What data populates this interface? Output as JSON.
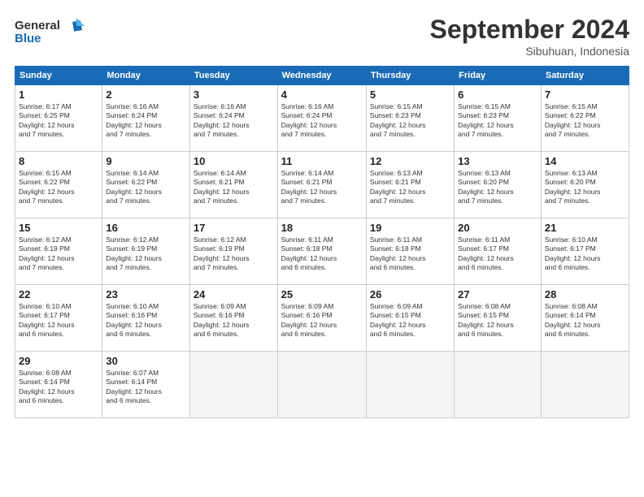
{
  "header": {
    "logo_line1": "General",
    "logo_line2": "Blue",
    "month_title": "September 2024",
    "location": "Sibuhuan, Indonesia"
  },
  "days_of_week": [
    "Sunday",
    "Monday",
    "Tuesday",
    "Wednesday",
    "Thursday",
    "Friday",
    "Saturday"
  ],
  "weeks": [
    [
      {
        "day": "1",
        "info": "Sunrise: 6:17 AM\nSunset: 6:25 PM\nDaylight: 12 hours\nand 7 minutes."
      },
      {
        "day": "2",
        "info": "Sunrise: 6:16 AM\nSunset: 6:24 PM\nDaylight: 12 hours\nand 7 minutes."
      },
      {
        "day": "3",
        "info": "Sunrise: 6:16 AM\nSunset: 6:24 PM\nDaylight: 12 hours\nand 7 minutes."
      },
      {
        "day": "4",
        "info": "Sunrise: 6:16 AM\nSunset: 6:24 PM\nDaylight: 12 hours\nand 7 minutes."
      },
      {
        "day": "5",
        "info": "Sunrise: 6:15 AM\nSunset: 6:23 PM\nDaylight: 12 hours\nand 7 minutes."
      },
      {
        "day": "6",
        "info": "Sunrise: 6:15 AM\nSunset: 6:23 PM\nDaylight: 12 hours\nand 7 minutes."
      },
      {
        "day": "7",
        "info": "Sunrise: 6:15 AM\nSunset: 6:22 PM\nDaylight: 12 hours\nand 7 minutes."
      }
    ],
    [
      {
        "day": "8",
        "info": "Sunrise: 6:15 AM\nSunset: 6:22 PM\nDaylight: 12 hours\nand 7 minutes."
      },
      {
        "day": "9",
        "info": "Sunrise: 6:14 AM\nSunset: 6:22 PM\nDaylight: 12 hours\nand 7 minutes."
      },
      {
        "day": "10",
        "info": "Sunrise: 6:14 AM\nSunset: 6:21 PM\nDaylight: 12 hours\nand 7 minutes."
      },
      {
        "day": "11",
        "info": "Sunrise: 6:14 AM\nSunset: 6:21 PM\nDaylight: 12 hours\nand 7 minutes."
      },
      {
        "day": "12",
        "info": "Sunrise: 6:13 AM\nSunset: 6:21 PM\nDaylight: 12 hours\nand 7 minutes."
      },
      {
        "day": "13",
        "info": "Sunrise: 6:13 AM\nSunset: 6:20 PM\nDaylight: 12 hours\nand 7 minutes."
      },
      {
        "day": "14",
        "info": "Sunrise: 6:13 AM\nSunset: 6:20 PM\nDaylight: 12 hours\nand 7 minutes."
      }
    ],
    [
      {
        "day": "15",
        "info": "Sunrise: 6:12 AM\nSunset: 6:19 PM\nDaylight: 12 hours\nand 7 minutes."
      },
      {
        "day": "16",
        "info": "Sunrise: 6:12 AM\nSunset: 6:19 PM\nDaylight: 12 hours\nand 7 minutes."
      },
      {
        "day": "17",
        "info": "Sunrise: 6:12 AM\nSunset: 6:19 PM\nDaylight: 12 hours\nand 7 minutes."
      },
      {
        "day": "18",
        "info": "Sunrise: 6:11 AM\nSunset: 6:18 PM\nDaylight: 12 hours\nand 6 minutes."
      },
      {
        "day": "19",
        "info": "Sunrise: 6:11 AM\nSunset: 6:18 PM\nDaylight: 12 hours\nand 6 minutes."
      },
      {
        "day": "20",
        "info": "Sunrise: 6:11 AM\nSunset: 6:17 PM\nDaylight: 12 hours\nand 6 minutes."
      },
      {
        "day": "21",
        "info": "Sunrise: 6:10 AM\nSunset: 6:17 PM\nDaylight: 12 hours\nand 6 minutes."
      }
    ],
    [
      {
        "day": "22",
        "info": "Sunrise: 6:10 AM\nSunset: 6:17 PM\nDaylight: 12 hours\nand 6 minutes."
      },
      {
        "day": "23",
        "info": "Sunrise: 6:10 AM\nSunset: 6:16 PM\nDaylight: 12 hours\nand 6 minutes."
      },
      {
        "day": "24",
        "info": "Sunrise: 6:09 AM\nSunset: 6:16 PM\nDaylight: 12 hours\nand 6 minutes."
      },
      {
        "day": "25",
        "info": "Sunrise: 6:09 AM\nSunset: 6:16 PM\nDaylight: 12 hours\nand 6 minutes."
      },
      {
        "day": "26",
        "info": "Sunrise: 6:09 AM\nSunset: 6:15 PM\nDaylight: 12 hours\nand 6 minutes."
      },
      {
        "day": "27",
        "info": "Sunrise: 6:08 AM\nSunset: 6:15 PM\nDaylight: 12 hours\nand 6 minutes."
      },
      {
        "day": "28",
        "info": "Sunrise: 6:08 AM\nSunset: 6:14 PM\nDaylight: 12 hours\nand 6 minutes."
      }
    ],
    [
      {
        "day": "29",
        "info": "Sunrise: 6:08 AM\nSunset: 6:14 PM\nDaylight: 12 hours\nand 6 minutes."
      },
      {
        "day": "30",
        "info": "Sunrise: 6:07 AM\nSunset: 6:14 PM\nDaylight: 12 hours\nand 6 minutes."
      },
      {
        "day": "",
        "info": ""
      },
      {
        "day": "",
        "info": ""
      },
      {
        "day": "",
        "info": ""
      },
      {
        "day": "",
        "info": ""
      },
      {
        "day": "",
        "info": ""
      }
    ]
  ]
}
